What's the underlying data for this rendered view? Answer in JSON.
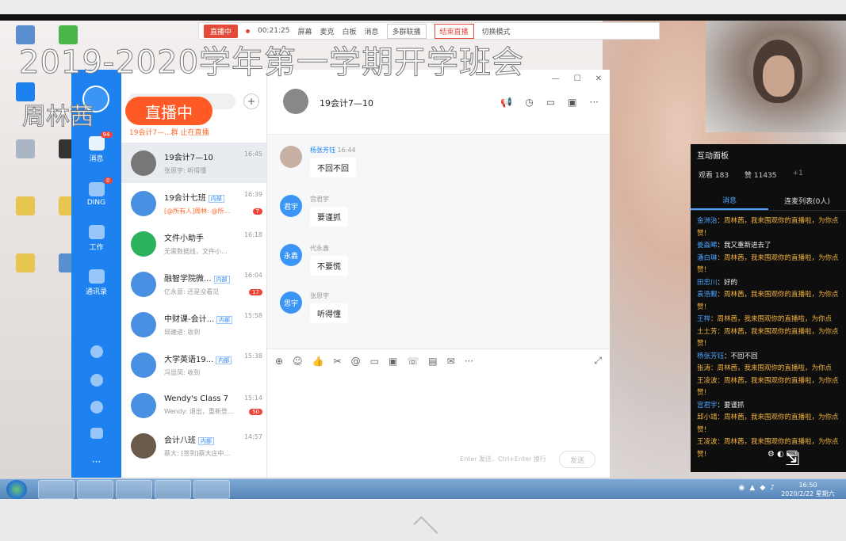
{
  "overlay": {
    "title": "2019-2020学年第一学期开学班会",
    "presenter": "周林茜",
    "live_badge": "直播中"
  },
  "control_bar": {
    "live": "直播中",
    "timer": "00:21:25",
    "items": [
      "屏幕",
      "麦克",
      "白板",
      "消息"
    ],
    "multi_group": "多群联播",
    "end": "结束直播",
    "switch_mode": "切换模式"
  },
  "sidebar": {
    "messages": "消息",
    "messages_badge": "94",
    "ding": "DING",
    "ding_badge": "0",
    "work": "工作",
    "contacts": "通讯录"
  },
  "conv_list": {
    "notice": "19会计7—...群 止在直播",
    "items": [
      {
        "name": "19会计7—10",
        "time": "16:45",
        "preview": "张思宇: 听得懂",
        "tag": "",
        "badge": ""
      },
      {
        "name": "19会计七班",
        "time": "16:39",
        "preview": "[@所有人]周林: @所...",
        "tag": "内部",
        "badge": "7"
      },
      {
        "name": "文件小助手",
        "time": "16:18",
        "preview": "无需数据线，文件小...",
        "tag": "",
        "badge": ""
      },
      {
        "name": "融智学院微...",
        "time": "16:04",
        "preview": "亿永意: 还是没看见",
        "tag": "内部",
        "badge": "17"
      },
      {
        "name": "中财课-会计...",
        "time": "15:58",
        "preview": "邱建进: 收到",
        "tag": "内部",
        "badge": ""
      },
      {
        "name": "大学英语19...",
        "time": "15:38",
        "preview": "冯显凤: 收到",
        "tag": "内部",
        "badge": ""
      },
      {
        "name": "Wendy's Class 7",
        "time": "15:14",
        "preview": "Wendy: 退出，重新登...",
        "tag": "",
        "badge": "50"
      },
      {
        "name": "会计八班",
        "time": "14:57",
        "preview": "蔡大: [签到]蔡大庄中...",
        "tag": "内部",
        "badge": ""
      }
    ]
  },
  "chat": {
    "title": "19会计7—10",
    "messages": [
      {
        "sender": "杨张芳钰",
        "time": "16:44",
        "text": "不回不回",
        "avatar": ""
      },
      {
        "sender": "宫君宇",
        "time": "",
        "text": "要谨抓",
        "avatar": "君宇"
      },
      {
        "sender": "代永鑫",
        "time": "",
        "text": "不要慌",
        "avatar": "永鑫"
      },
      {
        "sender": "张思宇",
        "time": "",
        "text": "听得懂",
        "avatar": "思宇"
      }
    ],
    "input_hint": "Enter 发送，Ctrl+Enter 换行",
    "send": "发送"
  },
  "interact": {
    "title": "互动面板",
    "viewers": "观看 183",
    "likes": "赞 11435",
    "plus_one": "+1",
    "tab_messages": "消息",
    "tab_linkmic": "连麦列表(0人)",
    "feed": [
      {
        "name": "金洲治",
        "text": "：周林茜，我来围观你的直播啦，为你点",
        "type": "g"
      },
      {
        "name": "",
        "text": "赞！",
        "type": "g"
      },
      {
        "name": "姜淼晞",
        "text": "：我又重新进去了",
        "type": "w"
      },
      {
        "name": "潘白琳",
        "text": "：周林茜，我来围观你的直播啦，为你点",
        "type": "g"
      },
      {
        "name": "",
        "text": "赞！",
        "type": "g"
      },
      {
        "name": "田忠川",
        "text": "：好的",
        "type": "w"
      },
      {
        "name": "袁浩觐",
        "text": "：周林茜，我来围观你的直播啦，为你点",
        "type": "g"
      },
      {
        "name": "",
        "text": "赞！",
        "type": "g"
      },
      {
        "name": "王梓",
        "text": "：周林茜，我来围观你的直播啦，为你点",
        "type": "g"
      },
      {
        "name": "",
        "text": "土土芳：周林茜，我来围观你的直播啦，为你点",
        "type": "g"
      },
      {
        "name": "",
        "text": "赞！",
        "type": "g"
      },
      {
        "name": "杨张芳钰",
        "text": "：不回不回",
        "type": "w"
      },
      {
        "name": "",
        "text": "张涛：周林茜，我来围观你的直播啦，为你点",
        "type": "g"
      },
      {
        "name": "",
        "text": "王凌波：周林茜，我来围观你的直播啦，为你点",
        "type": "g"
      },
      {
        "name": "",
        "text": "赞！",
        "type": "g"
      },
      {
        "name": "宫君宇",
        "text": "：要谨抓",
        "type": "w"
      },
      {
        "name": "",
        "text": "邱小靖：周林茜，我来围观你的直播啦，为你点",
        "type": "g"
      },
      {
        "name": "",
        "text": "赞！",
        "type": "g"
      },
      {
        "name": "",
        "text": "王凌波：周林茜，我来围观你的直播啦，为你点",
        "type": "g"
      },
      {
        "name": "",
        "text": "赞！",
        "type": "g"
      }
    ]
  },
  "taskbar": {
    "time": "16:50",
    "date": "2020/2/22 星期六"
  }
}
